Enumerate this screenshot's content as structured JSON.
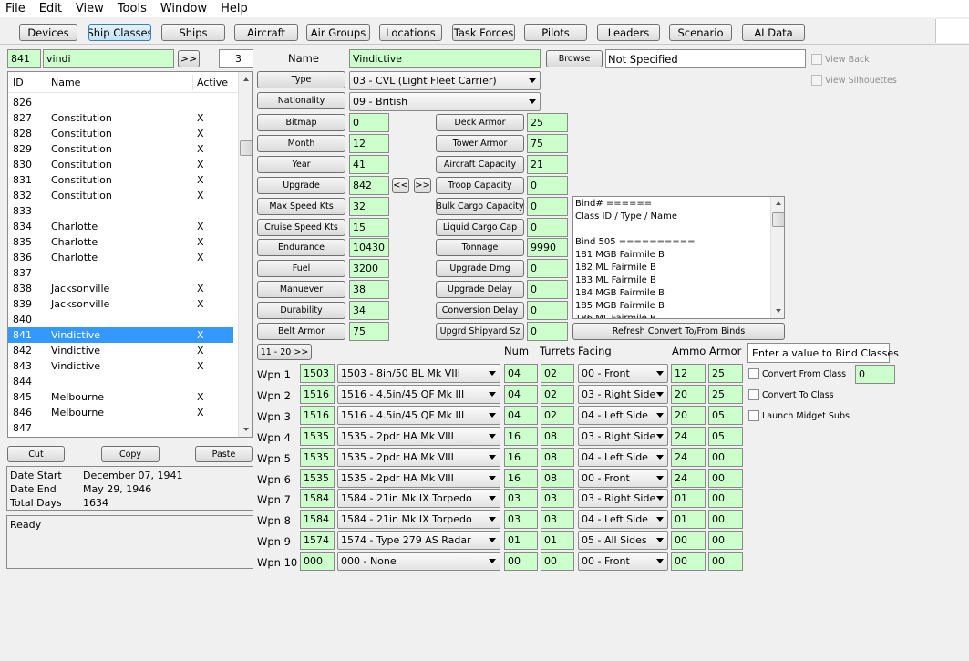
{
  "menu": [
    "File",
    "Edit",
    "View",
    "Tools",
    "Window",
    "Help"
  ],
  "tabs": [
    {
      "label": "Devices",
      "active": false
    },
    {
      "label": "Ship Classes",
      "active": true
    },
    {
      "label": "Ships",
      "active": false
    },
    {
      "label": "Aircraft",
      "active": false
    },
    {
      "label": "Air Groups",
      "active": false
    },
    {
      "label": "Locations",
      "active": false
    },
    {
      "label": "Task Forces",
      "active": false
    },
    {
      "label": "Pilots",
      "active": false
    },
    {
      "label": "Leaders",
      "active": false
    },
    {
      "label": "Scenario",
      "active": false
    },
    {
      "label": "AI Data",
      "active": false
    }
  ],
  "search": {
    "id": "841",
    "text": "vindi",
    "go_label": ">>",
    "count": "3"
  },
  "list": {
    "headers": {
      "id": "ID",
      "name": "Name",
      "active": "Active"
    },
    "rows": [
      {
        "id": "826",
        "name": "",
        "active": ""
      },
      {
        "id": "827",
        "name": "Constitution",
        "active": "X"
      },
      {
        "id": "828",
        "name": "Constitution",
        "active": "X"
      },
      {
        "id": "829",
        "name": "Constitution",
        "active": "X"
      },
      {
        "id": "830",
        "name": "Constitution",
        "active": "X"
      },
      {
        "id": "831",
        "name": "Constitution",
        "active": "X"
      },
      {
        "id": "832",
        "name": "Constitution",
        "active": "X"
      },
      {
        "id": "833",
        "name": "",
        "active": ""
      },
      {
        "id": "834",
        "name": "Charlotte",
        "active": "X"
      },
      {
        "id": "835",
        "name": "Charlotte",
        "active": "X"
      },
      {
        "id": "836",
        "name": "Charlotte",
        "active": "X"
      },
      {
        "id": "837",
        "name": "",
        "active": ""
      },
      {
        "id": "838",
        "name": "Jacksonville",
        "active": "X"
      },
      {
        "id": "839",
        "name": "Jacksonville",
        "active": "X"
      },
      {
        "id": "840",
        "name": "",
        "active": ""
      },
      {
        "id": "841",
        "name": "Vindictive",
        "active": "X",
        "selected": true
      },
      {
        "id": "842",
        "name": "Vindictive",
        "active": "X"
      },
      {
        "id": "843",
        "name": "Vindictive",
        "active": "X"
      },
      {
        "id": "844",
        "name": "",
        "active": ""
      },
      {
        "id": "845",
        "name": "Melbourne",
        "active": "X"
      },
      {
        "id": "846",
        "name": "Melbourne",
        "active": "X"
      },
      {
        "id": "847",
        "name": "",
        "active": ""
      }
    ]
  },
  "clipboard": {
    "cut": "Cut",
    "copy": "Copy",
    "paste": "Paste"
  },
  "dates": {
    "start_label": "Date Start",
    "start": "December 07, 1941",
    "end_label": "Date End",
    "end": "May 29, 1946",
    "days_label": "Total Days",
    "days": "1634"
  },
  "status": "Ready",
  "form": {
    "name_label": "Name",
    "name": "Vindictive",
    "browse_label": "Browse",
    "bitmap_file": "Not Specified",
    "type_label": "Type",
    "type": "03 - CVL (Light Fleet Carrier)",
    "nationality_label": "Nationality",
    "nationality": "09 - British",
    "view_back": "View Back",
    "view_silhouettes": "View Silhouettes",
    "upgrade_prev": "<<",
    "upgrade_next": ">>",
    "left_fields": [
      {
        "label": "Bitmap",
        "value": "0"
      },
      {
        "label": "Month",
        "value": "12"
      },
      {
        "label": "Year",
        "value": "41"
      },
      {
        "label": "Upgrade",
        "value": "842"
      },
      {
        "label": "Max Speed Kts",
        "value": "32"
      },
      {
        "label": "Cruise Speed Kts",
        "value": "15"
      },
      {
        "label": "Endurance",
        "value": "10430"
      },
      {
        "label": "Fuel",
        "value": "3200"
      },
      {
        "label": "Manuever",
        "value": "38"
      },
      {
        "label": "Durability",
        "value": "34"
      },
      {
        "label": "Belt Armor",
        "value": "75"
      }
    ],
    "right_fields": [
      {
        "label": "Deck Armor",
        "value": "25"
      },
      {
        "label": "Tower Armor",
        "value": "75"
      },
      {
        "label": "Aircraft Capacity",
        "value": "21"
      },
      {
        "label": "Troop Capacity",
        "value": "0"
      },
      {
        "label": "Bulk Cargo Capacity",
        "value": "0"
      },
      {
        "label": "Liquid Cargo Cap",
        "value": "0"
      },
      {
        "label": "Tonnage",
        "value": "9990"
      },
      {
        "label": "Upgrade Dmg",
        "value": "0"
      },
      {
        "label": "Upgrade Delay",
        "value": "0"
      },
      {
        "label": "Conversion Delay",
        "value": "0"
      },
      {
        "label": "Upgrd Shipyard Sz",
        "value": "0"
      }
    ]
  },
  "binds": {
    "lines": [
      "Bind# ======",
      "Class ID / Type / Name",
      "",
      "Bind 505 ==========",
      "181  MGB  Fairmile B",
      "182  ML   Fairmile B",
      "183  ML   Fairmile B",
      "184  MGB  Fairmile B",
      "185  MGB  Fairmile B",
      "186  ML   Fairmile B"
    ],
    "refresh_label": "Refresh Convert To/From Binds",
    "hint": "Enter a value to Bind Classes",
    "convert_from": "Convert From Class",
    "convert_from_value": "0",
    "convert_to": "Convert To Class",
    "launch_midget": "Launch Midget Subs"
  },
  "weapons": {
    "page_button": "11 - 20  >>",
    "headers": {
      "num": "Num",
      "turrets": "Turrets",
      "facing": "Facing",
      "ammo": "Ammo",
      "armor": "Armor"
    },
    "rows": [
      {
        "label": "Wpn 1",
        "code": "1503",
        "device": "1503 - 8in/50 BL Mk VIII",
        "num": "04",
        "turrets": "02",
        "facing": "00 - Front",
        "ammo": "12",
        "armor": "25"
      },
      {
        "label": "Wpn 2",
        "code": "1516",
        "device": "1516 - 4.5in/45 QF Mk III",
        "num": "04",
        "turrets": "02",
        "facing": "03 - Right Side",
        "ammo": "20",
        "armor": "25"
      },
      {
        "label": "Wpn 3",
        "code": "1516",
        "device": "1516 - 4.5in/45 QF Mk III",
        "num": "04",
        "turrets": "02",
        "facing": "04 - Left Side",
        "ammo": "20",
        "armor": "05"
      },
      {
        "label": "Wpn 4",
        "code": "1535",
        "device": "1535 - 2pdr HA Mk VIII",
        "num": "16",
        "turrets": "08",
        "facing": "03 - Right Side",
        "ammo": "24",
        "armor": "05"
      },
      {
        "label": "Wpn 5",
        "code": "1535",
        "device": "1535 - 2pdr HA Mk VIII",
        "num": "16",
        "turrets": "08",
        "facing": "04 - Left Side",
        "ammo": "24",
        "armor": "00"
      },
      {
        "label": "Wpn 6",
        "code": "1535",
        "device": "1535 - 2pdr HA Mk VIII",
        "num": "16",
        "turrets": "08",
        "facing": "00 - Front",
        "ammo": "24",
        "armor": "00"
      },
      {
        "label": "Wpn 7",
        "code": "1584",
        "device": "1584 - 21in Mk IX Torpedo",
        "num": "03",
        "turrets": "03",
        "facing": "03 - Right Side",
        "ammo": "01",
        "armor": "00"
      },
      {
        "label": "Wpn 8",
        "code": "1584",
        "device": "1584 - 21in Mk IX Torpedo",
        "num": "03",
        "turrets": "03",
        "facing": "04 - Left Side",
        "ammo": "01",
        "armor": "00"
      },
      {
        "label": "Wpn 9",
        "code": "1574",
        "device": "1574 - Type 279 AS Radar",
        "num": "01",
        "turrets": "01",
        "facing": "05 - All Sides",
        "ammo": "00",
        "armor": "00"
      },
      {
        "label": "Wpn 10",
        "code": "000",
        "device": "000 - None",
        "num": "00",
        "turrets": "00",
        "facing": "00 - Front",
        "ammo": "00",
        "armor": "00"
      }
    ]
  }
}
